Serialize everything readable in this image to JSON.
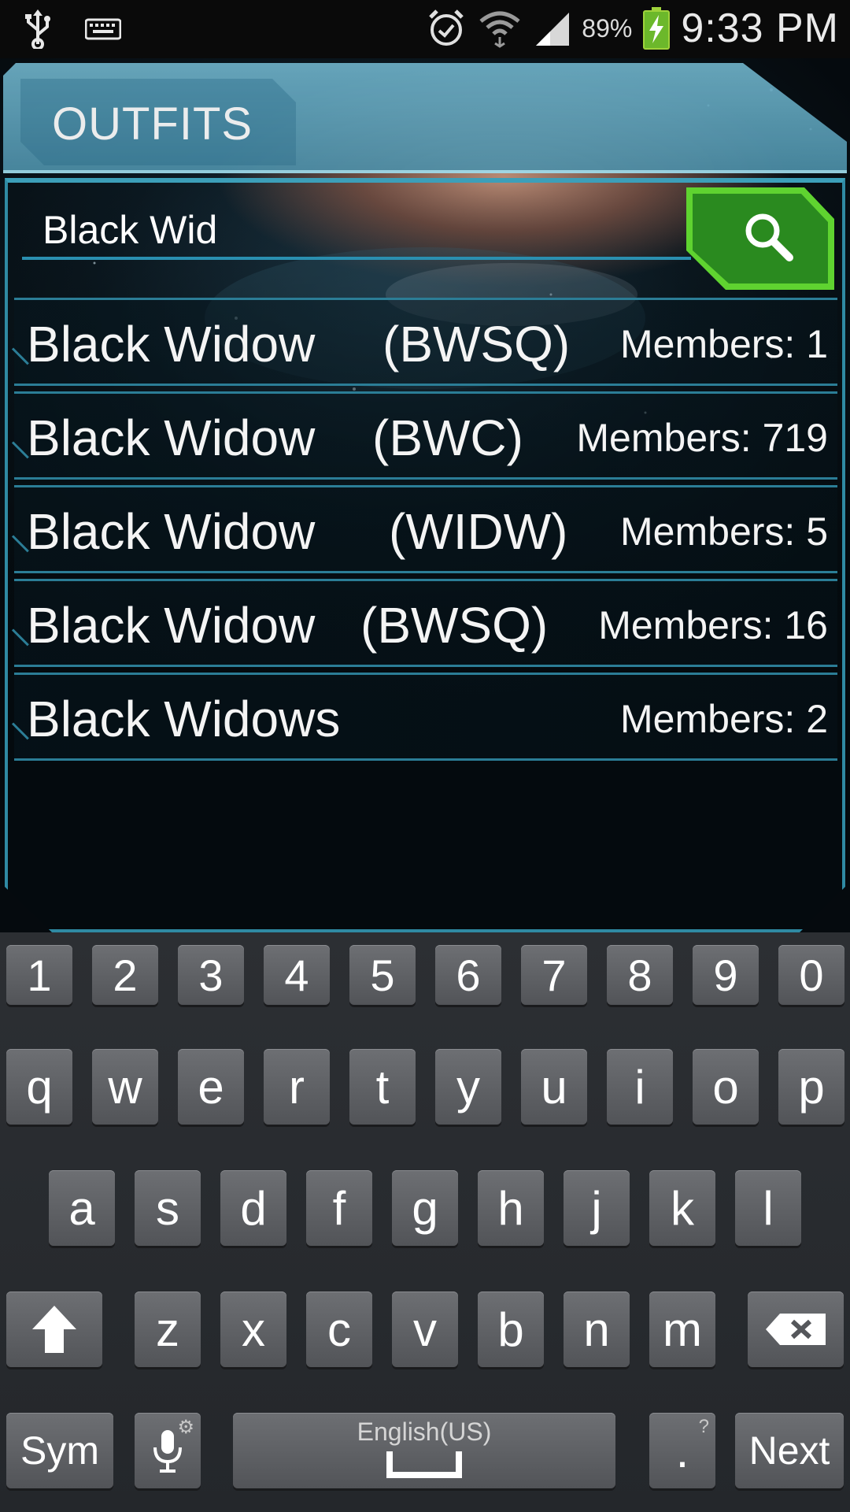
{
  "status_bar": {
    "time": "9:33 PM",
    "battery_percent": "89%",
    "icons": [
      "usb-icon",
      "keyboard-icon",
      "alarm-icon",
      "wifi-icon",
      "signal-icon",
      "battery-charging-icon"
    ]
  },
  "header": {
    "title": "OUTFITS"
  },
  "search": {
    "value": "Black Wid",
    "button_icon": "search-icon"
  },
  "results": [
    {
      "name": "Black Widow",
      "tag": "(BWSQ)",
      "members": "Members: 1"
    },
    {
      "name": "Black Widow",
      "tag": "(BWC)",
      "members": "Members: 719"
    },
    {
      "name": "Black Widow",
      "tag": "(WIDW)",
      "members": "Members: 5"
    },
    {
      "name": "Black Widow",
      "tag": "(BWSQ)",
      "members": "Members: 16"
    },
    {
      "name": "Black Widows",
      "tag": "",
      "members": "Members: 2"
    }
  ],
  "keyboard": {
    "numbers": [
      "1",
      "2",
      "3",
      "4",
      "5",
      "6",
      "7",
      "8",
      "9",
      "0"
    ],
    "row1": [
      "q",
      "w",
      "e",
      "r",
      "t",
      "y",
      "u",
      "i",
      "o",
      "p"
    ],
    "row2": [
      "a",
      "s",
      "d",
      "f",
      "g",
      "h",
      "j",
      "k",
      "l"
    ],
    "row3": [
      "z",
      "x",
      "c",
      "v",
      "b",
      "n",
      "m"
    ],
    "sym_label": "Sym",
    "space_label": "English(US)",
    "period_label": ".",
    "period_hint": "?",
    "next_label": "Next"
  }
}
